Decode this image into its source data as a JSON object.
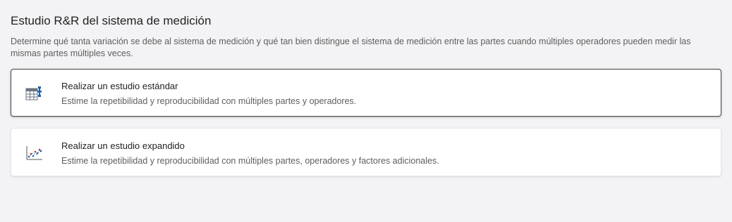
{
  "header": {
    "title": "Estudio R&R del sistema de medición",
    "description": "Determine qué tanta variación se debe al sistema de medición y qué tan bien distingue el sistema de medición entre las partes cuando múltiples operadores pueden medir las mismas partes múltiples veces."
  },
  "options": [
    {
      "title": "Realizar un estudio estándar",
      "subtitle": "Estime la repetibilidad y reproducibilidad con múltiples partes y operadores.",
      "icon": "worksheet-gage-icon",
      "selected": true
    },
    {
      "title": "Realizar un estudio expandido",
      "subtitle": "Estime la repetibilidad y reproducibilidad con múltiples partes, operadores y factores adicionales.",
      "icon": "scatterplot-icon",
      "selected": false
    }
  ],
  "colors": {
    "background": "#f3f3f5",
    "card": "#ffffff",
    "selected_border": "#444444",
    "icon_blue": "#1f5fa6",
    "icon_red": "#c0392b"
  }
}
